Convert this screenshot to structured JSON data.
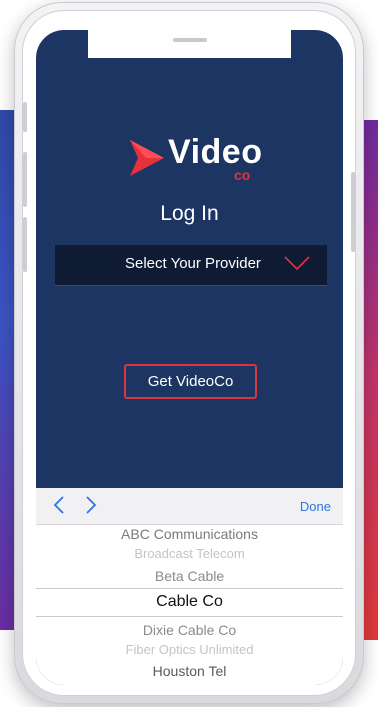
{
  "app": {
    "brand": "Video",
    "brand_sub": "co"
  },
  "login": {
    "title": "Log In",
    "provider_placeholder": "Select Your Provider",
    "get_button": "Get VideoCo"
  },
  "picker": {
    "done_label": "Done",
    "options": [
      {
        "label": "ABC Communications",
        "state": "normal"
      },
      {
        "label": "Broadcast Telecom",
        "state": "faded"
      },
      {
        "label": "Beta Cable",
        "state": "normal"
      },
      {
        "label": "Cable Co",
        "state": "selected"
      },
      {
        "label": "Dixie Cable Co",
        "state": "normal"
      },
      {
        "label": "Fiber Optics Unlimited",
        "state": "faded"
      },
      {
        "label": "Houston Tel",
        "state": "normal"
      }
    ]
  },
  "colors": {
    "screen_bg": "#1d3562",
    "accent_red": "#e6313a",
    "ios_blue": "#2f74e0"
  },
  "icons": {
    "logo": "play-triangle-icon",
    "provider_dropdown": "chevron-down-icon",
    "picker_prev": "chevron-left-icon",
    "picker_next": "chevron-right-icon"
  }
}
